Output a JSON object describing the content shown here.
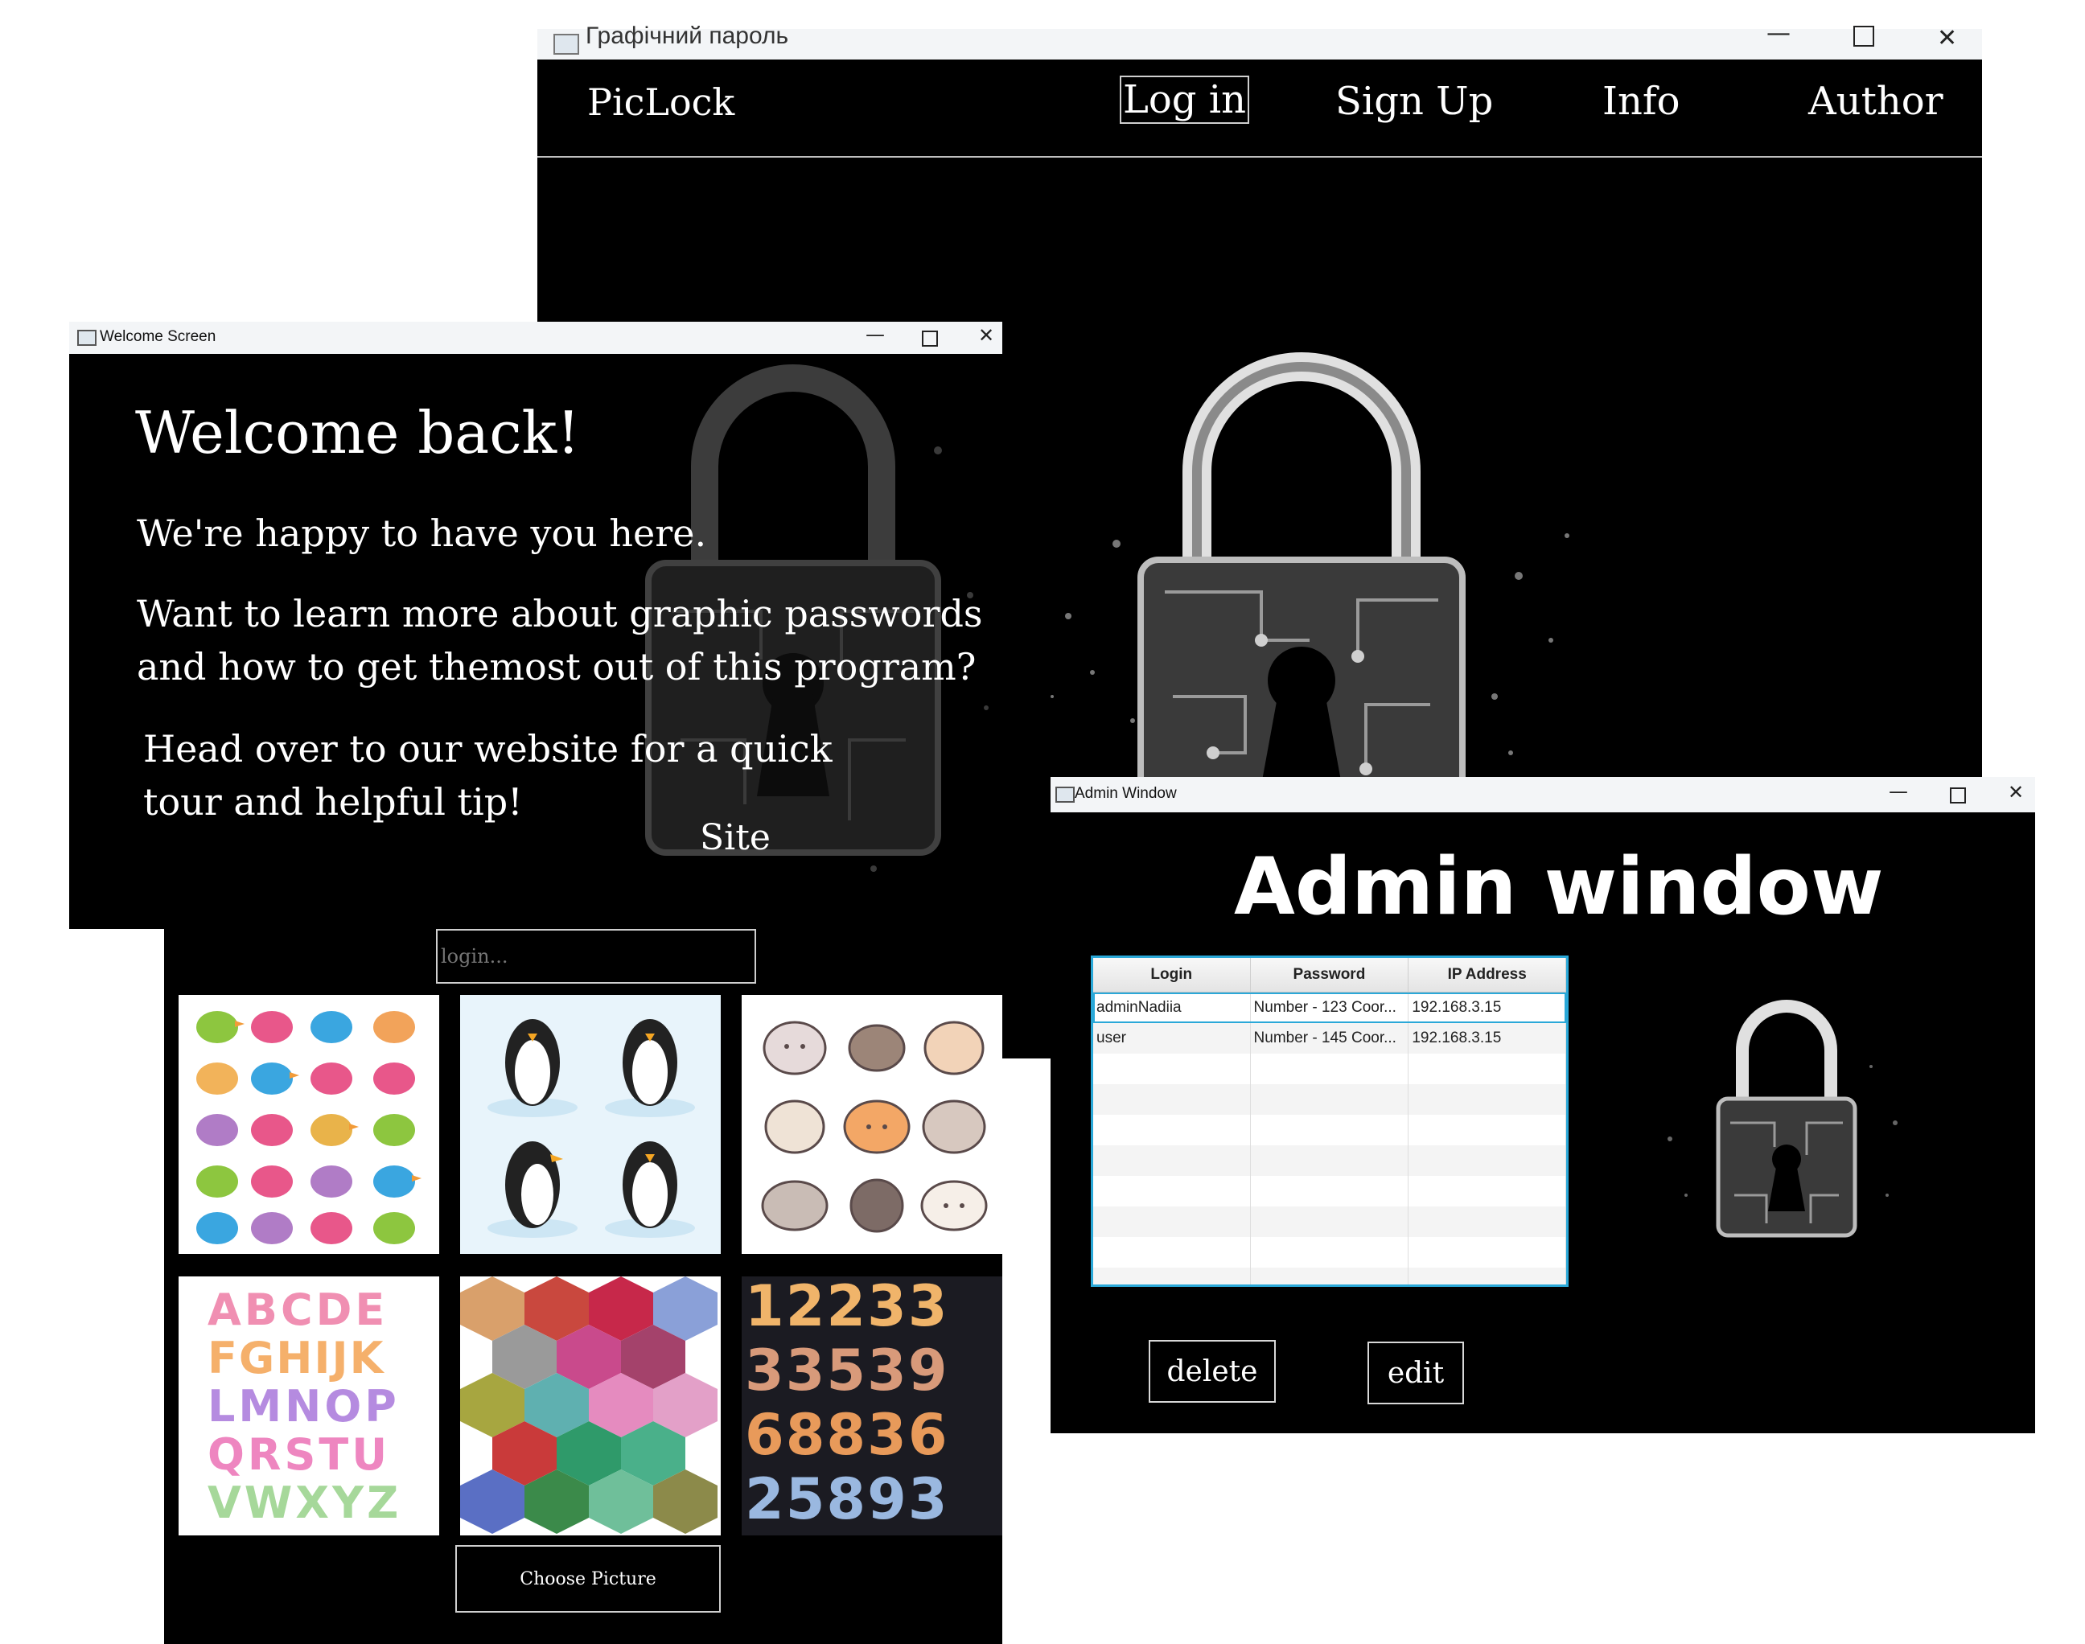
{
  "main_window": {
    "title": "Графічний пароль",
    "minimize_icon": "minimize-icon",
    "maximize_icon": "maximize-icon",
    "close_icon": "close-icon",
    "nav": {
      "brand": "PicLock",
      "items": [
        "Log in",
        "Sign Up",
        "Info",
        "Author"
      ],
      "active_item": "Log in"
    }
  },
  "welcome_window": {
    "title": "Welcome Screen",
    "heading": "Welcome back!",
    "line1": "We're happy to have you here.",
    "para2_line1": "Want to learn more about graphic passwords",
    "para2_line2": "and how to get themost out of this program?",
    "para3_line1": "Head over to our website for a quick",
    "para3_line2": "tour and helpful tip!",
    "site_link": "Site"
  },
  "login_panel": {
    "login_placeholder": "login...",
    "choose_button": "Choose Picture",
    "tiles": [
      "birds",
      "penguins",
      "cats",
      "letters",
      "cubes",
      "numbers"
    ],
    "letters_rows": [
      "ABCDE",
      "FGHIJK",
      "LMNOP",
      "QRSTU",
      "VWXYZ"
    ],
    "numbers_rows": [
      "12233",
      "33539",
      "68836",
      "25893"
    ]
  },
  "admin_window": {
    "title": "Admin Window",
    "heading": "Admin window",
    "table": {
      "columns": [
        "Login",
        "Password",
        "IP Address"
      ],
      "rows": [
        [
          "adminNadiia",
          "Number - 123 Coor...",
          "192.168.3.15"
        ],
        [
          "user",
          "Number - 145 Coor...",
          "192.168.3.15"
        ]
      ],
      "empty_rows": 8
    },
    "delete_button": "delete",
    "edit_button": "edit"
  },
  "colors": {
    "window_bg": "#000000",
    "titlebar_bg": "#f3f5f7",
    "table_border": "#2aa8d8",
    "text": "#ffffff"
  }
}
